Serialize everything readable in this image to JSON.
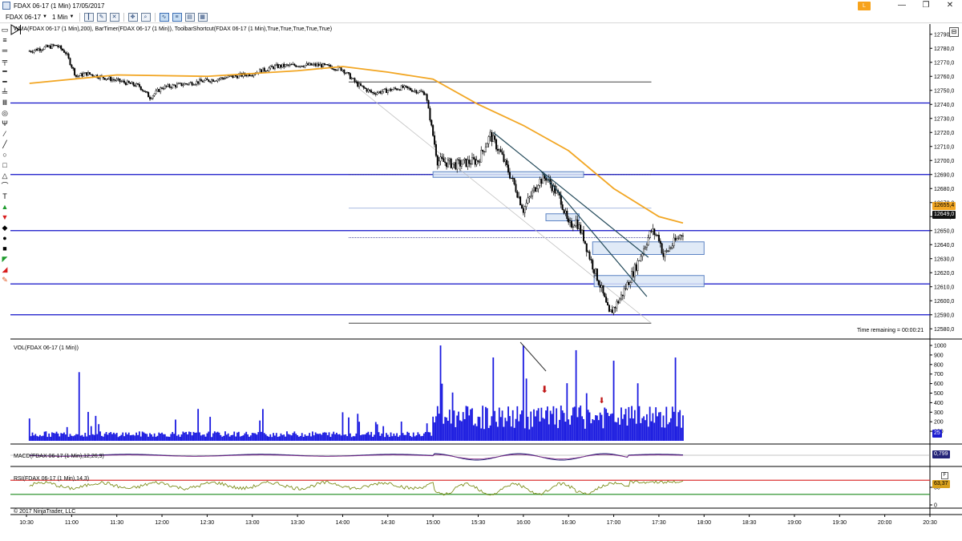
{
  "window": {
    "title": "FDAX 06-17 (1 Min)  17/05/2017",
    "link_button": "L",
    "minimize": "—",
    "restore": "❐",
    "close": "✕"
  },
  "toolbar": {
    "instrument": "FDAX 06-17",
    "interval": "1 Min"
  },
  "left_tools": [
    "▭",
    "≡",
    "═",
    "╤",
    "━",
    "━",
    "╧",
    "Ⅲ",
    "◎",
    "Ψ",
    "⁄",
    "╱",
    "○",
    "□",
    "△",
    "⌒",
    "T",
    "▲",
    "▼",
    "◆",
    "●",
    "■",
    "◤",
    "◢",
    "✎"
  ],
  "chart": {
    "main_indicators_label": "WMA(FDAX 06-17 (1 Min),200), BarTimer(FDAX 06-17 (1 Min)), ToolbarShortcut(FDAX 06-17 (1 Min),True,True,True,True,True)",
    "volume_label": "VOL(FDAX 06-17 (1 Min))",
    "macd_label": "MACD(FDAX 06-17 (1 Min),12,26,9)",
    "rsi_label": "RSI(FDAX 06-17 (1 Min),14,3)",
    "copyright": "© 2017 NinjaTrader, LLC",
    "time_remaining": "Time remaining = 00:00:21",
    "price_ticks": [
      "12790,0",
      "12780,0",
      "12770,0",
      "12760,0",
      "12750,0",
      "12740,0",
      "12730,0",
      "12720,0",
      "12710,0",
      "12700,0",
      "12690,0",
      "12680,0",
      "12670,0",
      "12660,0",
      "12650,0",
      "12640,0",
      "12630,0",
      "12620,0",
      "12610,0",
      "12600,0",
      "12590,0",
      "12580,0"
    ],
    "volume_ticks": [
      "1000",
      "900",
      "800",
      "700",
      "600",
      "500",
      "400",
      "300",
      "200",
      "100"
    ],
    "rsi_ticks": [
      "50",
      "0"
    ],
    "time_ticks": [
      "10:30",
      "11:00",
      "11:30",
      "12:00",
      "12:30",
      "13:00",
      "13:30",
      "14:00",
      "14:30",
      "15:00",
      "15:30",
      "16:00",
      "16:30",
      "17:00",
      "17:30",
      "18:00",
      "18:30",
      "19:00",
      "19:30",
      "20:00",
      "20:30"
    ],
    "wma_tag": "12655,4",
    "last_tag": "12649,0",
    "vol_tag": "25",
    "macd_tag": "0,799",
    "rsi_tag": "63,37",
    "panel_button": "F",
    "colors": {
      "price_line": "#1111c8",
      "wma": "#f2a623",
      "volume": "#1a1ae0",
      "rsi": "#7d8e1c",
      "rsi_upper": "#d81c1c",
      "rsi_lower": "#1c8a1c",
      "zone_fill": "#dbe6f6",
      "zone_border": "#5b82c4"
    }
  },
  "chart_data": {
    "type": "candlestick",
    "instrument": "FDAX 06-17",
    "interval": "1 Min",
    "date": "17/05/2017",
    "x_range": [
      "10:30",
      "20:30"
    ],
    "y_range": [
      12575,
      12795
    ],
    "price_path": [
      [
        "10:32",
        12778
      ],
      [
        "10:40",
        12780
      ],
      [
        "10:50",
        12782
      ],
      [
        "10:56",
        12777
      ],
      [
        "11:03",
        12760
      ],
      [
        "11:10",
        12762
      ],
      [
        "11:30",
        12757
      ],
      [
        "11:45",
        12753
      ],
      [
        "11:52",
        12745
      ],
      [
        "12:00",
        12752
      ],
      [
        "12:30",
        12757
      ],
      [
        "13:00",
        12762
      ],
      [
        "13:15",
        12767
      ],
      [
        "13:30",
        12768
      ],
      [
        "13:45",
        12768
      ],
      [
        "14:00",
        12765
      ],
      [
        "14:10",
        12754
      ],
      [
        "14:20",
        12748
      ],
      [
        "14:40",
        12752
      ],
      [
        "14:55",
        12748
      ],
      [
        "15:03",
        12700
      ],
      [
        "15:15",
        12697
      ],
      [
        "15:30",
        12700
      ],
      [
        "15:38",
        12718
      ],
      [
        "15:45",
        12705
      ],
      [
        "15:55",
        12680
      ],
      [
        "16:00",
        12665
      ],
      [
        "16:10",
        12685
      ],
      [
        "16:15",
        12688
      ],
      [
        "16:25",
        12672
      ],
      [
        "16:30",
        12653
      ],
      [
        "16:35",
        12657
      ],
      [
        "16:40",
        12645
      ],
      [
        "16:45",
        12628
      ],
      [
        "16:51",
        12611
      ],
      [
        "16:57",
        12590
      ],
      [
        "17:05",
        12603
      ],
      [
        "17:15",
        12625
      ],
      [
        "17:25",
        12650
      ],
      [
        "17:30",
        12645
      ],
      [
        "17:33",
        12632
      ],
      [
        "17:39",
        12640
      ],
      [
        "17:46",
        12649
      ]
    ],
    "wma_200": [
      [
        "10:32",
        12755
      ],
      [
        "11:30",
        12761
      ],
      [
        "12:30",
        12760
      ],
      [
        "13:30",
        12764
      ],
      [
        "14:00",
        12767
      ],
      [
        "14:30",
        12763
      ],
      [
        "15:00",
        12758
      ],
      [
        "15:30",
        12740
      ],
      [
        "16:00",
        12725
      ],
      [
        "16:30",
        12707
      ],
      [
        "17:00",
        12680
      ],
      [
        "17:30",
        12660
      ],
      [
        "17:46",
        12655.4
      ]
    ],
    "horizontal_levels": [
      12741,
      12690,
      12650,
      12612,
      12590
    ],
    "short_levels": [
      12756,
      12584
    ],
    "dotted_levels": [
      12690,
      12645
    ],
    "zones": [
      {
        "from": "15:00",
        "to": "16:40",
        "low": 12688,
        "high": 12692
      },
      {
        "from": "16:15",
        "to": "16:37",
        "low": 12657,
        "high": 12662
      },
      {
        "from": "16:46",
        "to": "18:00",
        "low": 12633,
        "high": 12642
      },
      {
        "from": "16:47",
        "to": "18:00",
        "low": 12610,
        "high": 12618
      }
    ],
    "volume_peak": 1000,
    "rsi_levels": [
      70,
      30
    ]
  }
}
